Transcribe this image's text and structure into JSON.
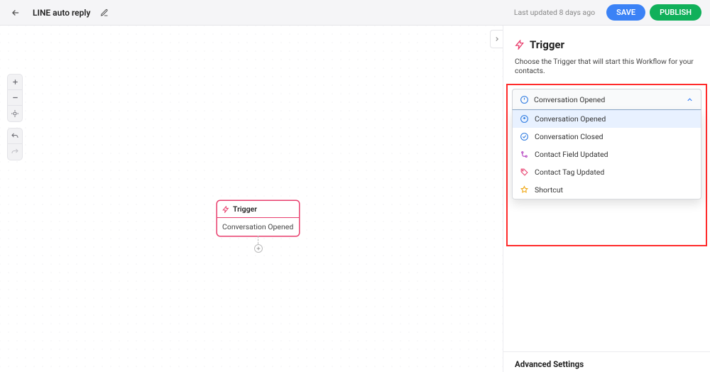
{
  "header": {
    "title": "LINE auto reply",
    "last_updated": "Last updated 8 days ago",
    "save_label": "SAVE",
    "publish_label": "PUBLISH"
  },
  "canvas": {
    "node": {
      "header_label": "Trigger",
      "body_label": "Conversation Opened"
    }
  },
  "panel": {
    "title": "Trigger",
    "description": "Choose the Trigger that will start this Workflow for your contacts.",
    "selected": "Conversation Opened",
    "options": [
      {
        "label": "Conversation Opened",
        "icon": "convo-open",
        "color": "#2f7be0"
      },
      {
        "label": "Conversation Closed",
        "icon": "convo-close",
        "color": "#2f7be0"
      },
      {
        "label": "Contact Field Updated",
        "icon": "field",
        "color": "#b23fbf"
      },
      {
        "label": "Contact Tag Updated",
        "icon": "tag",
        "color": "#e83e6d"
      },
      {
        "label": "Shortcut",
        "icon": "shortcut",
        "color": "#f0a712"
      }
    ],
    "advanced_label": "Advanced Settings"
  }
}
